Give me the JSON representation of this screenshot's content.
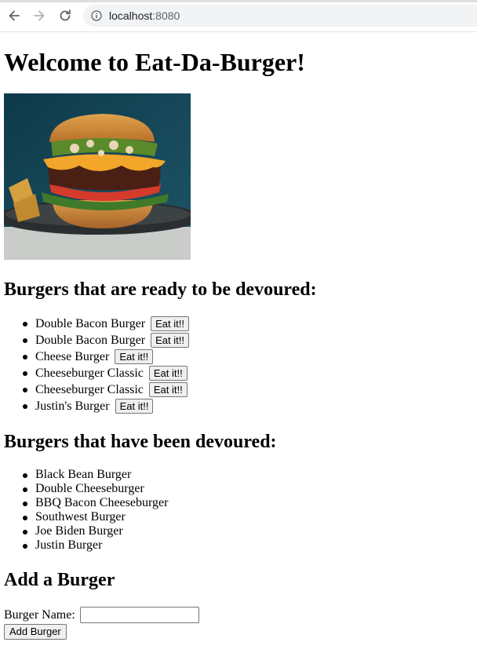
{
  "browser": {
    "url_host": "localhost",
    "url_port": ":8080",
    "icons": {
      "back": "back-arrow-icon",
      "forward": "forward-arrow-icon",
      "reload": "reload-icon",
      "site_info": "info-icon"
    }
  },
  "page": {
    "title": "Welcome to Eat-Da-Burger!",
    "hero_image": "burger-photo",
    "ready_heading": "Burgers that are ready to be devoured:",
    "ready": [
      {
        "name": "Double Bacon Burger",
        "button": "Eat it!!"
      },
      {
        "name": "Double Bacon Burger",
        "button": "Eat it!!"
      },
      {
        "name": "Cheese Burger",
        "button": "Eat it!!"
      },
      {
        "name": "Cheeseburger Classic",
        "button": "Eat it!!"
      },
      {
        "name": "Cheeseburger Classic",
        "button": "Eat it!!"
      },
      {
        "name": "Justin's Burger",
        "button": "Eat it!!"
      }
    ],
    "devoured_heading": "Burgers that have been devoured:",
    "devoured": [
      "Black Bean Burger",
      "Double Cheeseburger",
      "BBQ Bacon Cheeseburger",
      "Southwest Burger",
      "Joe Biden Burger",
      "Justin Burger"
    ],
    "add_heading": "Add a Burger",
    "form": {
      "label": "Burger Name:",
      "value": "",
      "submit_label": "Add Burger"
    }
  }
}
